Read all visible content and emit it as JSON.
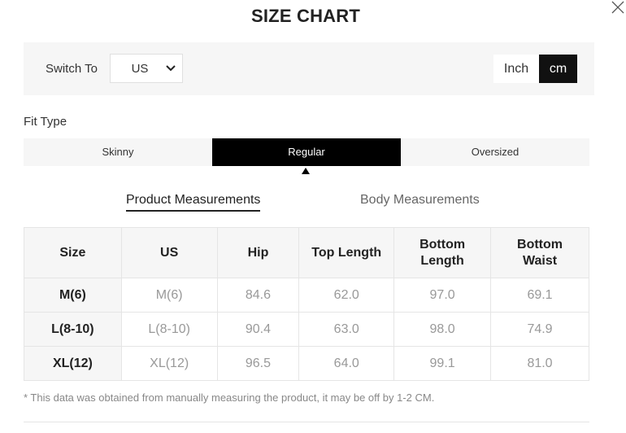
{
  "title": "SIZE CHART",
  "switch": {
    "label": "Switch To",
    "selected_region": "US",
    "units": [
      "Inch",
      "cm"
    ],
    "active_unit": "cm"
  },
  "fit_type": {
    "label": "Fit Type",
    "options": [
      "Skinny",
      "Regular",
      "Oversized"
    ],
    "active": "Regular"
  },
  "measurement_tabs": {
    "product": "Product Measurements",
    "body": "Body Measurements",
    "active": "Product Measurements"
  },
  "table": {
    "headers": [
      "Size",
      "US",
      "Hip",
      "Top Length",
      "Bottom Length",
      "Bottom Waist"
    ],
    "rows": [
      [
        "M(6)",
        "M(6)",
        "84.6",
        "62.0",
        "97.0",
        "69.1"
      ],
      [
        "L(8-10)",
        "L(8-10)",
        "90.4",
        "63.0",
        "98.0",
        "74.9"
      ],
      [
        "XL(12)",
        "XL(12)",
        "96.5",
        "64.0",
        "99.1",
        "81.0"
      ]
    ]
  },
  "note": "* This data was obtained from manually measuring the product, it may be off by 1-2 CM.",
  "icons": {
    "close": "close-icon",
    "dropdown": "chevron-down-icon",
    "active_indicator": "caret-up-icon"
  }
}
